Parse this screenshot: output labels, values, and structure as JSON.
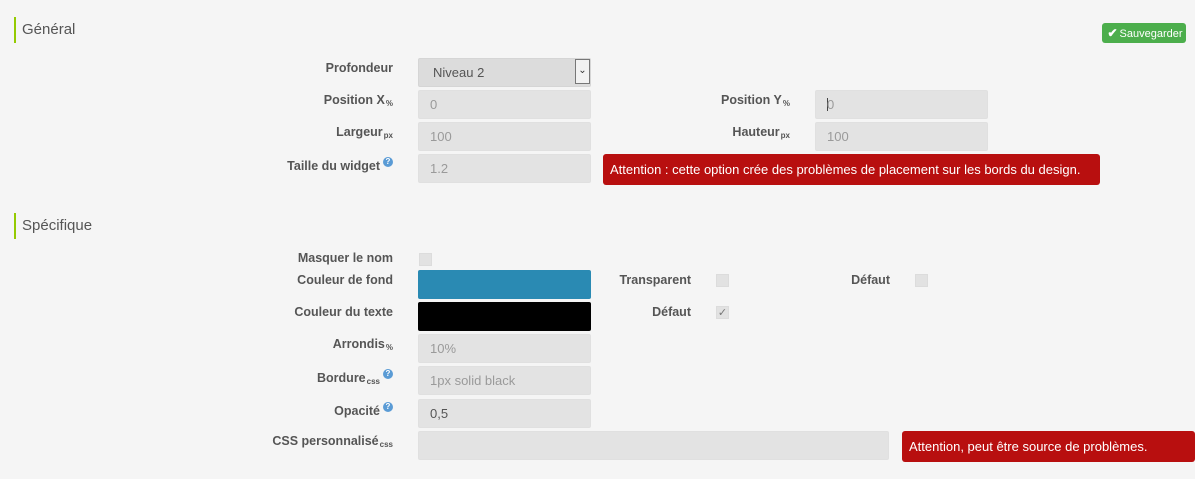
{
  "general": {
    "title": "Général",
    "save_label": "Sauvegarder",
    "depth": {
      "label": "Profondeur",
      "value": "Niveau 2"
    },
    "pos_x": {
      "label": "Position X",
      "unit": "%",
      "value": "0"
    },
    "pos_y": {
      "label": "Position Y",
      "unit": "%",
      "value": "0"
    },
    "width": {
      "label": "Largeur",
      "unit": "px",
      "value": "100"
    },
    "height": {
      "label": "Hauteur",
      "unit": "px",
      "value": "100"
    },
    "widget_size": {
      "label": "Taille du widget",
      "value": "1.2"
    },
    "widget_size_warning": "Attention : cette option crée des problèmes de placement sur les bords du design."
  },
  "specific": {
    "title": "Spécifique",
    "hide_name": {
      "label": "Masquer le nom",
      "checked": false
    },
    "bg_color": {
      "label": "Couleur de fond",
      "color": "#2a8ab3"
    },
    "transparent": {
      "label": "Transparent",
      "checked": false
    },
    "bg_default": {
      "label": "Défaut",
      "checked": false
    },
    "text_color": {
      "label": "Couleur du texte",
      "color": "#000000"
    },
    "text_default": {
      "label": "Défaut",
      "checked": true
    },
    "rounding": {
      "label": "Arrondis",
      "unit": "%",
      "value": "10%"
    },
    "border": {
      "label": "Bordure",
      "unit": "css",
      "value": "1px solid black"
    },
    "opacity": {
      "label": "Opacité",
      "value": "0,5"
    },
    "custom_css": {
      "label": "CSS personnalisé",
      "unit": "css",
      "value": "",
      "warning": "Attention, peut être source de problèmes."
    }
  },
  "colors": {
    "accent": "#94ca02",
    "save": "#4cae4c",
    "alert": "#b80f0f",
    "help": "#5a9bd5"
  }
}
